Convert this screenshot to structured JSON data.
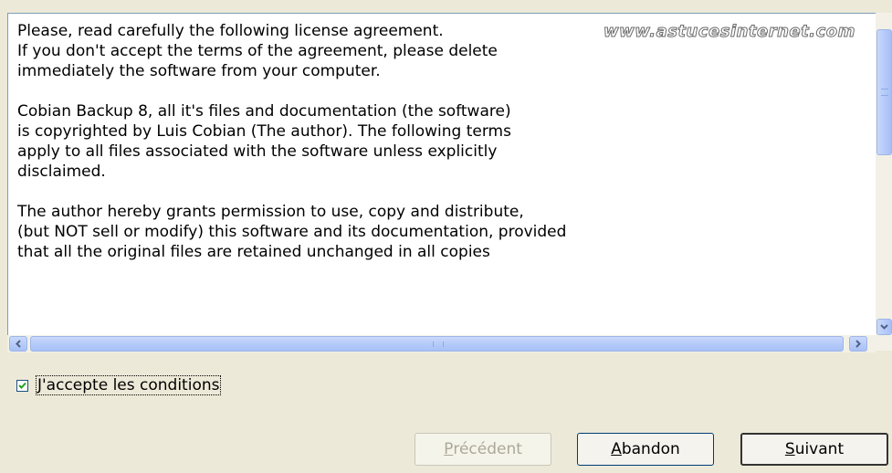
{
  "license": {
    "lines": [
      "Please, read carefully the following license agreement.",
      "If you don't accept the terms of the agreement, please delete",
      "immediately the software from your computer.",
      "",
      "Cobian Backup 8, all it's files and documentation (the software)",
      "is copyrighted by Luis Cobian (The author). The following terms",
      "apply to all files associated with the software unless explicitly",
      "disclaimed.",
      "",
      "The author hereby grants permission to use, copy and distribute,",
      "(but NOT sell or modify) this software and its documentation, provided",
      "that all the original files are retained unchanged in all copies"
    ]
  },
  "watermark": "www.astucesinternet.com",
  "accept_checkbox": {
    "label": "J'accepte les conditions",
    "checked": true
  },
  "buttons": {
    "previous": {
      "first": "P",
      "rest": "récédent",
      "enabled": false
    },
    "abandon": {
      "first": "A",
      "rest": "bandon",
      "enabled": true
    },
    "next": {
      "first": "S",
      "rest": "uivant",
      "enabled": true
    }
  },
  "icons": {
    "scroll_up": "scroll-up-arrow-icon",
    "scroll_down": "scroll-down-arrow-icon",
    "scroll_left": "scroll-left-arrow-icon",
    "scroll_right": "scroll-right-arrow-icon",
    "check": "checkmark-icon"
  },
  "colors": {
    "window_bg": "#ece9d8",
    "scroll_thumb": "#b6cbf9",
    "button_border": "#003c74",
    "disabled_text": "#aca899"
  }
}
